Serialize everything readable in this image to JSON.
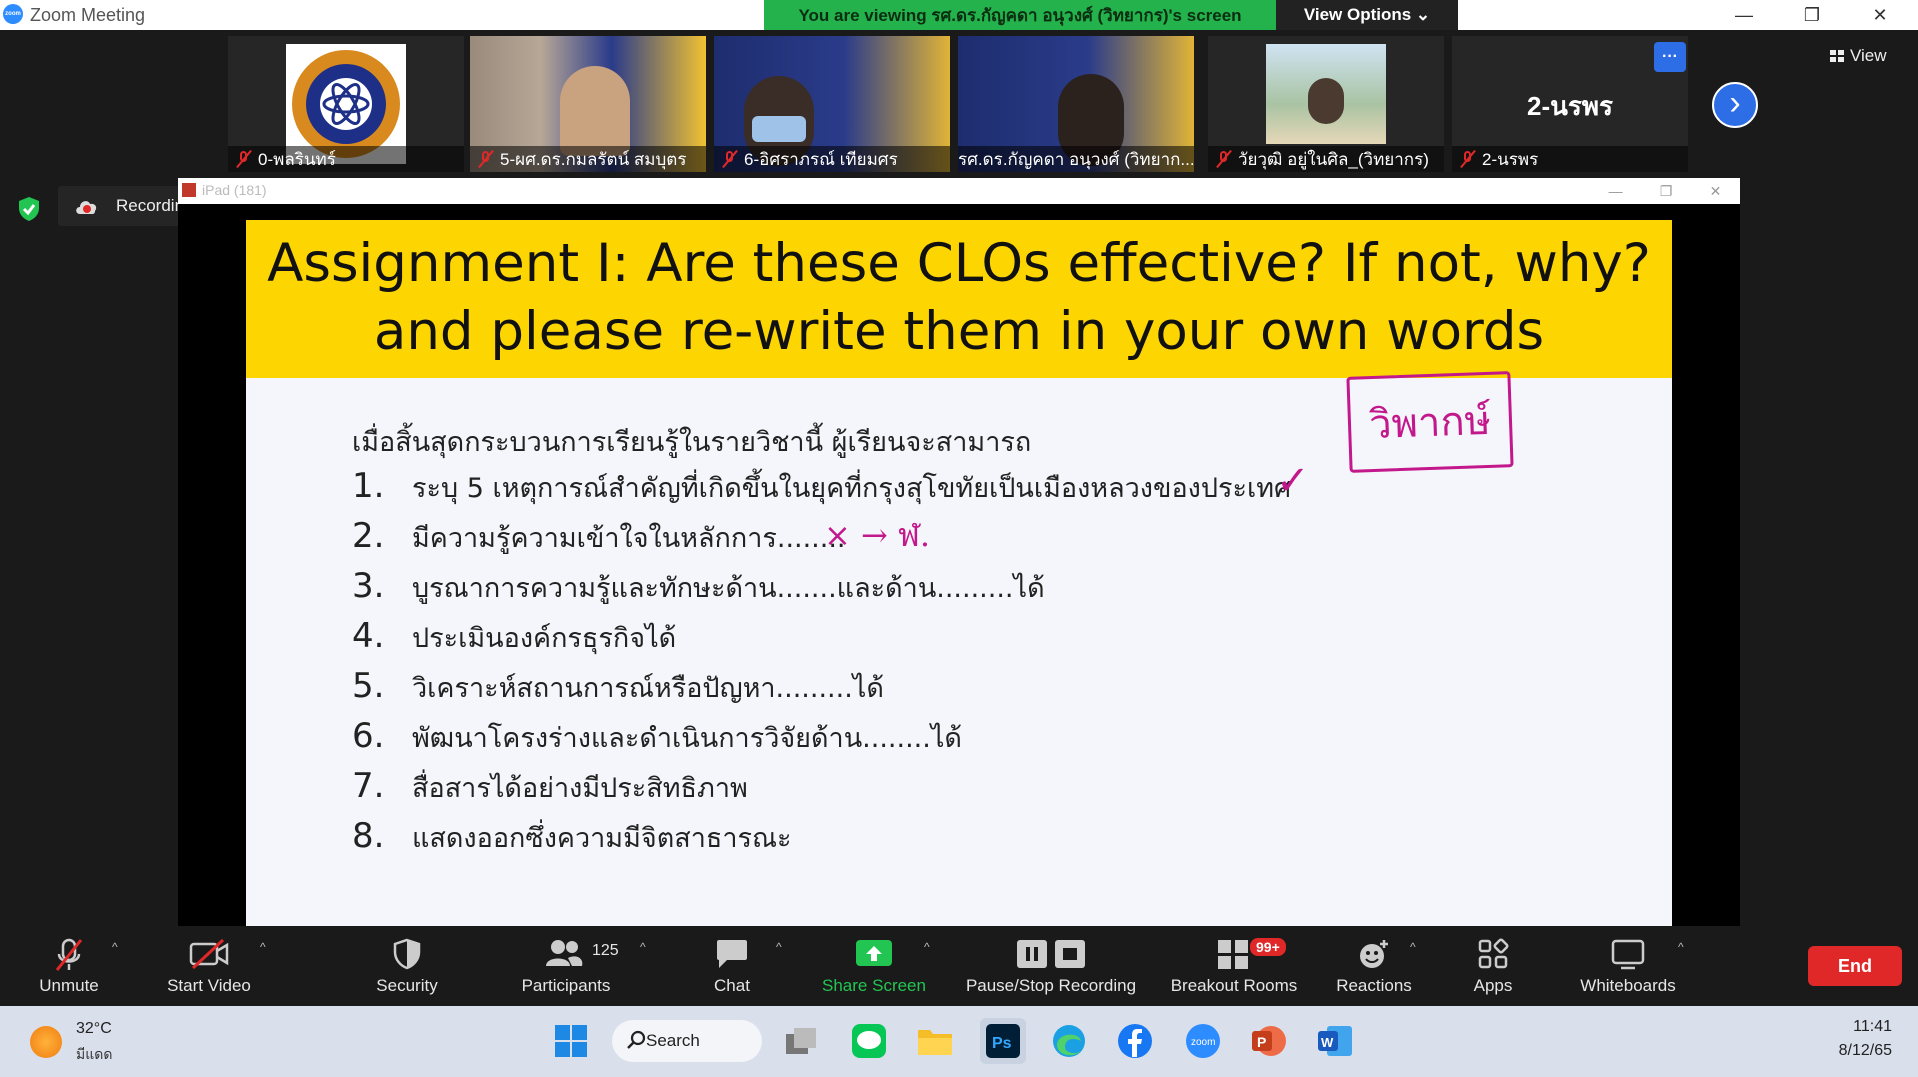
{
  "window": {
    "app_title": "Zoom Meeting",
    "viewing_banner": "You are viewing รศ.ดร.กัญคดา อนุวงศ์ (วิทยากร)'s screen",
    "view_options": "View Options ⌄",
    "minimize": "—",
    "restore": "❐",
    "close": "✕"
  },
  "gallery": {
    "tiles": [
      {
        "name": "0-พลรินทร์"
      },
      {
        "name": "5-ผศ.ดร.กมลรัตน์ สมบุตร"
      },
      {
        "name": "6-อิศราภรณ์  เทียมศร"
      },
      {
        "name": "รศ.ดร.กัญคดา อนุวงศ์ (วิทยาก..."
      },
      {
        "name": "วัยวุฒิ อยู่ในศิล_(วิทยากร)"
      },
      {
        "name": "2-นรพร",
        "big_name": "2-นรพร"
      }
    ],
    "more_button": "···",
    "next_button": "›",
    "view_label": "View"
  },
  "recording": {
    "label": "Recording..."
  },
  "share": {
    "window_title": "iPad (181)",
    "slide_title_line1": "Assignment I: Are these CLOs effective? If not, why?",
    "slide_title_line2": "and please re-write them in your own words",
    "intro": "เมื่อสิ้นสุดกระบวนการเรียนรู้ในรายวิชานี้ ผู้เรียนจะสามารถ",
    "clos": [
      {
        "num": "1.",
        "text": "ระบุ 5 เหตุการณ์สำคัญที่เกิดขึ้นในยุคที่กรุงสุโขทัยเป็นเมืองหลวงของประเทศ"
      },
      {
        "num": "2.",
        "text": "มีความรู้ความเข้าใจในหลักการ........"
      },
      {
        "num": "3.",
        "text": "บูรณาการความรู้และทักษะด้าน.......และด้าน.........ได้"
      },
      {
        "num": "4.",
        "text": "ประเมินองค์กรธุรกิจได้"
      },
      {
        "num": "5.",
        "text": "วิเคราะห์สถานการณ์หรือปัญหา.........ได้"
      },
      {
        "num": "6.",
        "text": "พัฒนาโครงร่างและดำเนินการวิจัยด้าน........ได้"
      },
      {
        "num": "7.",
        "text": "สื่อสารได้อย่างมีประสิทธิภาพ"
      },
      {
        "num": "8.",
        "text": "แสดงออกซึ่งความมีจิตสาธารณะ"
      }
    ],
    "annotation_box": "วิพากษ์",
    "annotation_arrow": "× → ฬ.",
    "annotation_check": "✓"
  },
  "toolbar": {
    "unmute": "Unmute",
    "start_video": "Start Video",
    "security": "Security",
    "participants": "Participants",
    "participants_count": "125",
    "chat": "Chat",
    "share_screen": "Share Screen",
    "pause_stop": "Pause/Stop Recording",
    "breakout": "Breakout Rooms",
    "breakout_badge": "99+",
    "reactions": "Reactions",
    "apps": "Apps",
    "whiteboards": "Whiteboards",
    "end": "End",
    "share_color": "#23c552",
    "end_color": "#e02828"
  },
  "taskbar": {
    "weather_temp": "32°C",
    "weather_desc": "มีแดด",
    "search": "Search",
    "time": "11:41",
    "date": "8/12/65"
  }
}
